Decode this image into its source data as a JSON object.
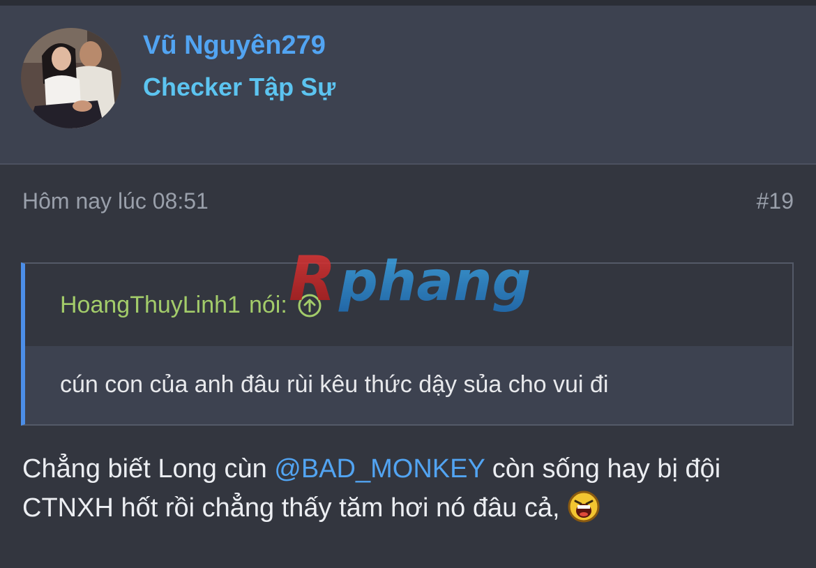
{
  "user": {
    "name": "Vũ Nguyên279",
    "title": "Checker Tập Sự"
  },
  "post": {
    "time": "Hôm nay lúc 08:51",
    "number": "#19"
  },
  "quote": {
    "author": "HoangThuyLinh1",
    "said_label": "nói:",
    "text": "cún con của anh đâu rùi kêu thức dậy sủa cho vui đi"
  },
  "message": {
    "part1": "Chẳng biết Long cùn ",
    "mention": "@BAD_MONKEY",
    "part2": " còn sống hay bị đội CTNXH hốt rồi chẳng thấy tăm hơi nó đâu cả,"
  },
  "watermark": {
    "text": "Rphang"
  },
  "colors": {
    "background": "#33363f",
    "header_background": "#3d4250",
    "username": "#52a4f2",
    "user_title": "#5cc4f0",
    "quote_author": "#a3cc6a",
    "quote_border": "#4c8ee8",
    "mention": "#52a4f2"
  },
  "icons": {
    "quote_jump": "arrow-up-circle-icon",
    "emoji": "shouting-face-emoji-icon"
  }
}
